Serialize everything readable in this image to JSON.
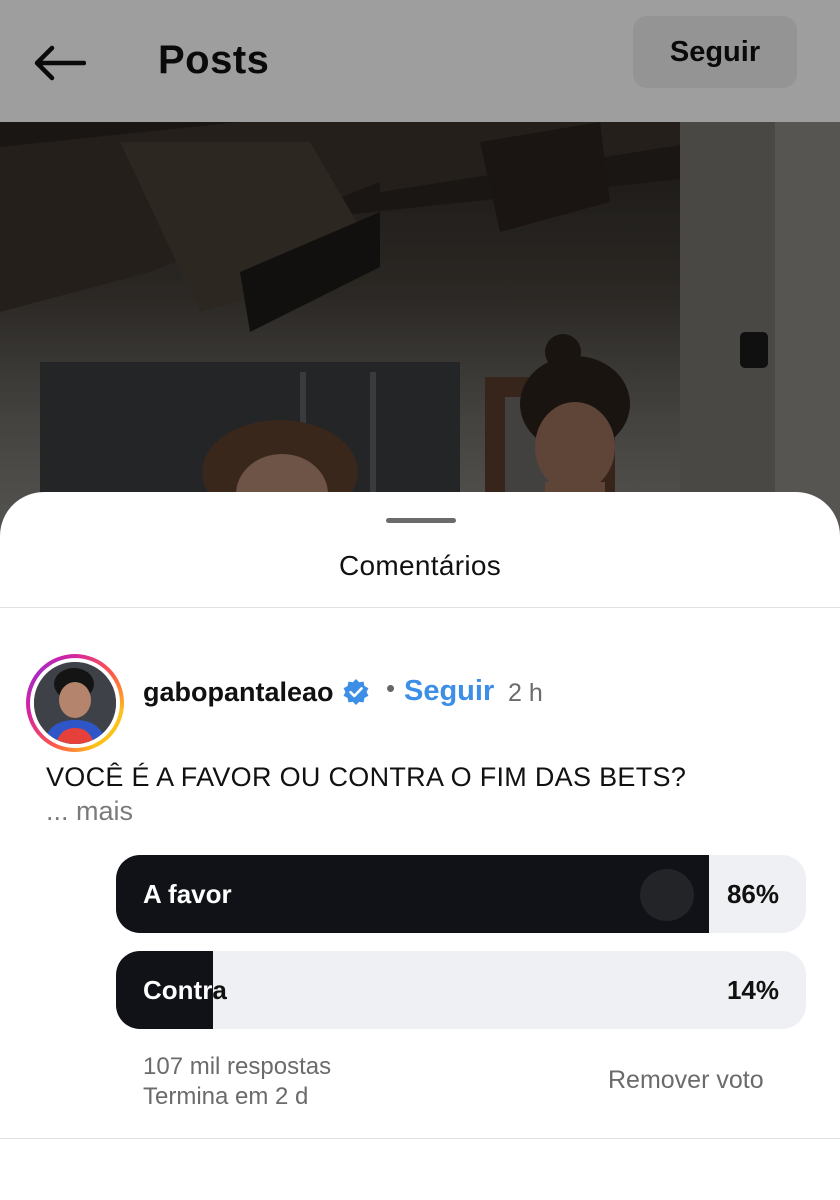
{
  "header": {
    "title": "Posts",
    "follow_label": "Seguir"
  },
  "sheet": {
    "title": "Comentários"
  },
  "comment": {
    "username": "gabopantaleao",
    "follow_label": "Seguir",
    "separator": "•",
    "time": "2 h",
    "text": "VOCÊ É A FAVOR OU CONTRA O FIM DAS BETS?",
    "more_label": "... mais"
  },
  "poll": {
    "options": [
      {
        "label": "A favor",
        "percent_text": "86%",
        "fraction": 0.86
      },
      {
        "label": "Contra",
        "percent_text": "14%",
        "fraction": 0.14
      }
    ],
    "responses": "107 mil respostas",
    "ends": "Termina em 2 d",
    "remove_vote_label": "Remover voto"
  },
  "colors": {
    "accent_link": "#3d8ee6",
    "poll_fill": "#101217",
    "poll_track": "#eff0f3",
    "verified_badge": "#3d8ee6"
  },
  "icons": {
    "back": "arrow-left-icon",
    "verified": "verified-badge-icon"
  }
}
